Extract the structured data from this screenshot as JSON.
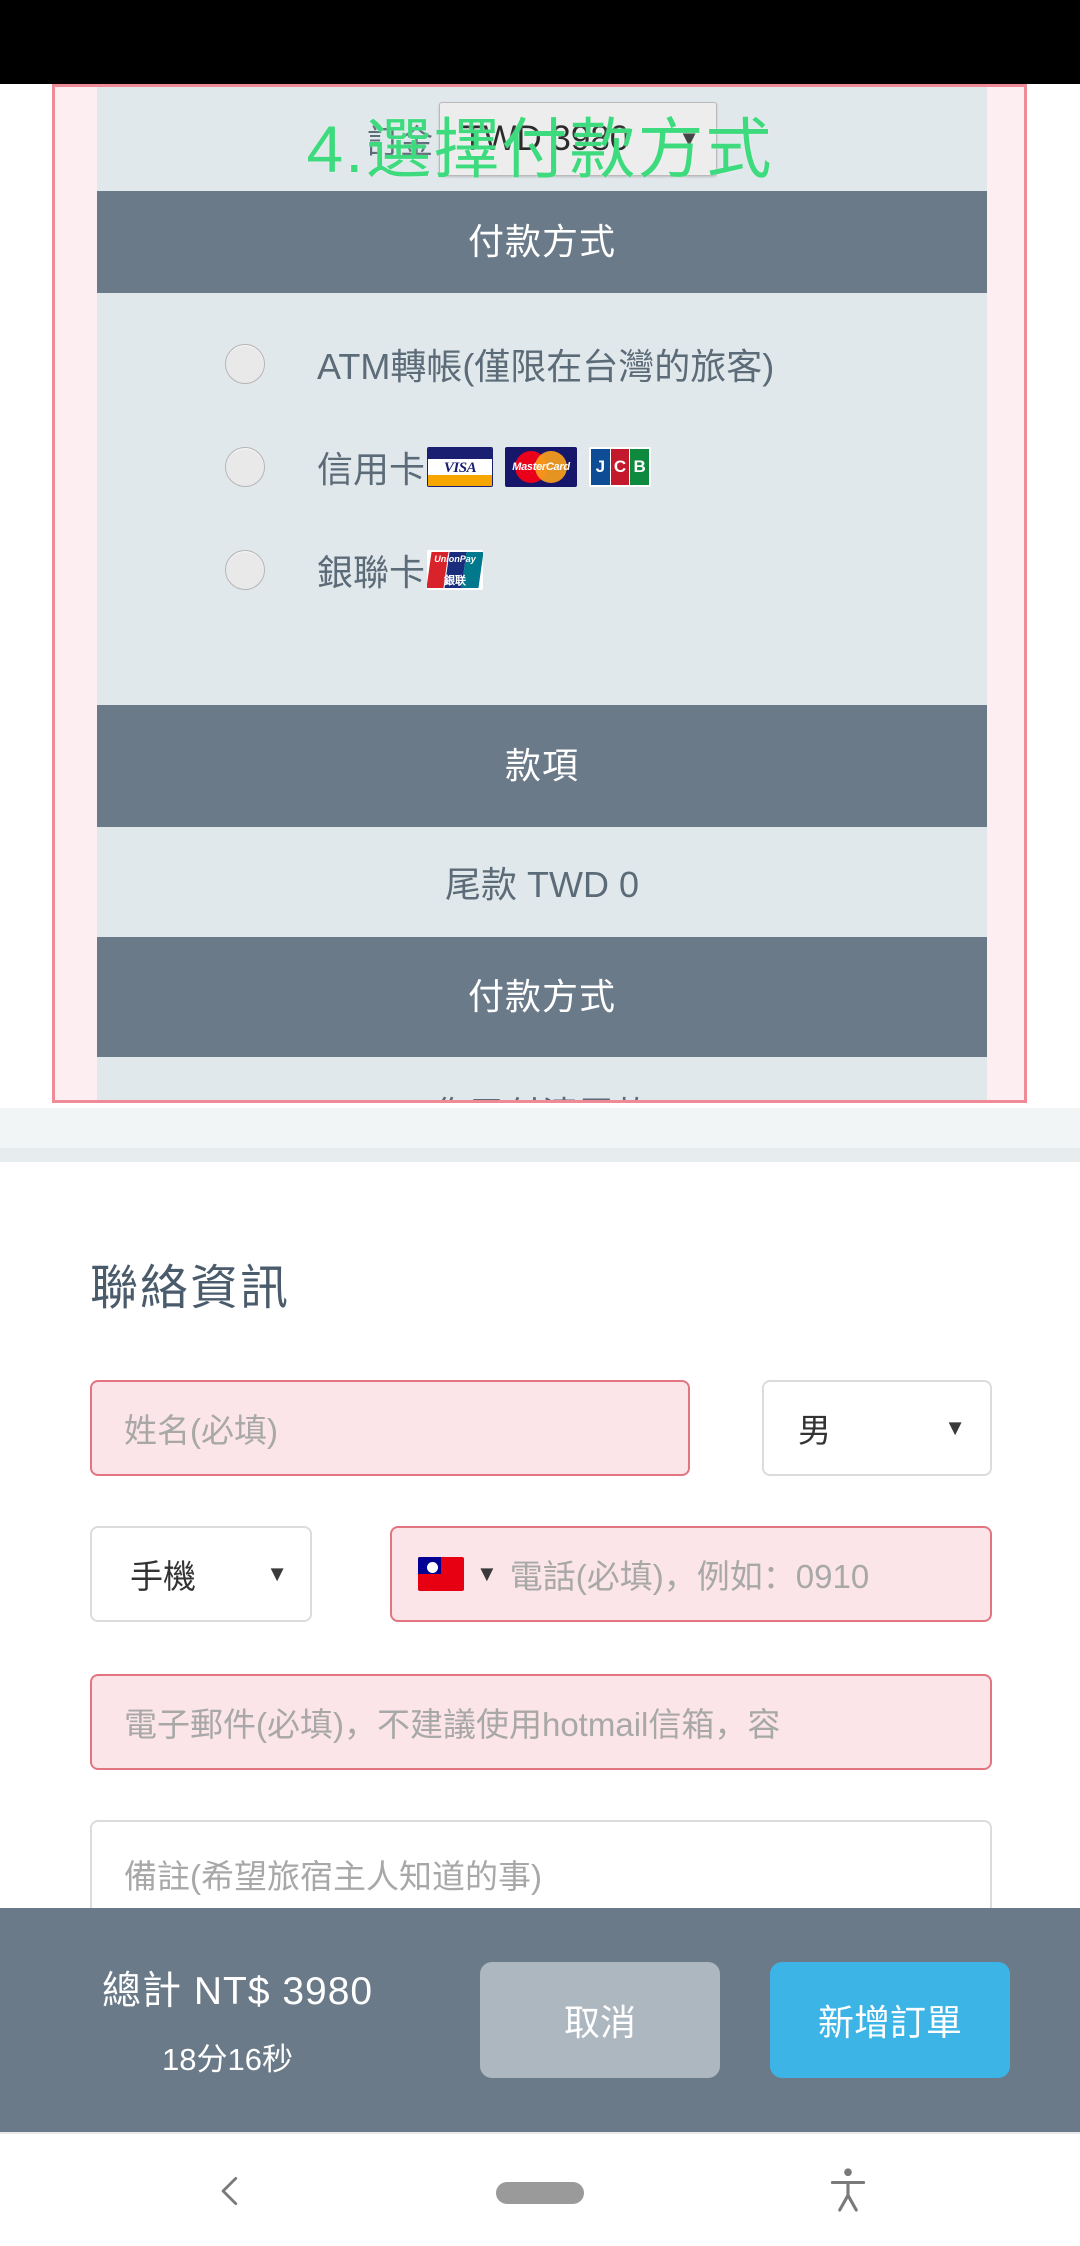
{
  "booking": {
    "deposit_label": "訂金",
    "deposit_value": "TWD 3980",
    "step_title": "4.選擇付款方式",
    "payment_method_header": "付款方式",
    "options": [
      {
        "label": "ATM轉帳(僅限在台灣的旅客)",
        "logos": []
      },
      {
        "label": "信用卡",
        "logos": [
          "visa-logo",
          "mastercard-logo",
          "jcb-logo"
        ]
      },
      {
        "label": "銀聯卡",
        "logos": [
          "unionpay-logo"
        ]
      }
    ],
    "amount_header": "款項",
    "amount_value": "尾款 TWD 0",
    "final_payment_header": "付款方式",
    "final_payment_value": "您已付清尾款"
  },
  "contact": {
    "title": "聯絡資訊",
    "name_placeholder": "姓名(必填)",
    "gender_value": "男",
    "phone_type_value": "手機",
    "phone_placeholder": "電話(必填)，例如：0910",
    "email_placeholder": "電子郵件(必填)，不建議使用hotmail信箱，容",
    "note_placeholder": "備註(希望旅宿主人知道的事)",
    "flag_icon": "taiwan-flag-icon",
    "caret_icon": "▼"
  },
  "summary": {
    "total_label": "總計 NT$ 3980",
    "timer": "18分16秒",
    "cancel_label": "取消",
    "submit_label": "新增訂單"
  },
  "navbar": {
    "back_icon": "chevron-left-icon",
    "home_icon": "home-pill-icon",
    "accessibility_icon": "accessibility-icon"
  },
  "colors": {
    "accent_blue": "#3cb4e5",
    "panel_dark": "#6b7a89",
    "panel_light": "#e1e8eb",
    "error_border": "#e2757f",
    "error_bg": "#fbe5e8",
    "green_title": "#3ddb7e"
  }
}
